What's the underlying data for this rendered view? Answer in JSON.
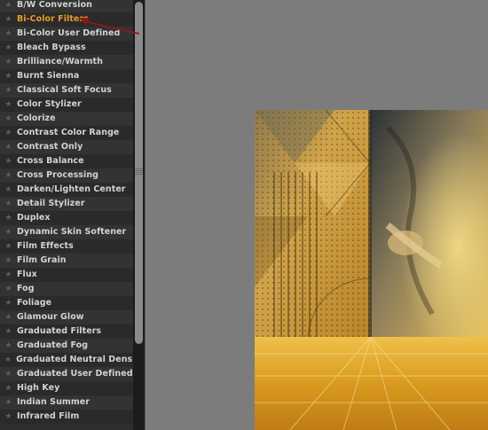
{
  "filter_panel": {
    "selected_index": 1,
    "items": [
      {
        "label": "B/W Conversion"
      },
      {
        "label": "Bi-Color Filters"
      },
      {
        "label": "Bi-Color User Defined"
      },
      {
        "label": "Bleach Bypass"
      },
      {
        "label": "Brilliance/Warmth"
      },
      {
        "label": "Burnt Sienna"
      },
      {
        "label": "Classical Soft Focus"
      },
      {
        "label": "Color Stylizer"
      },
      {
        "label": "Colorize"
      },
      {
        "label": "Contrast Color Range"
      },
      {
        "label": "Contrast Only"
      },
      {
        "label": "Cross Balance"
      },
      {
        "label": "Cross Processing"
      },
      {
        "label": "Darken/Lighten Center"
      },
      {
        "label": "Detail Stylizer"
      },
      {
        "label": "Duplex"
      },
      {
        "label": "Dynamic Skin Softener"
      },
      {
        "label": "Film Effects"
      },
      {
        "label": "Film Grain"
      },
      {
        "label": "Flux"
      },
      {
        "label": "Fog"
      },
      {
        "label": "Foliage"
      },
      {
        "label": "Glamour Glow"
      },
      {
        "label": "Graduated Filters"
      },
      {
        "label": "Graduated Fog"
      },
      {
        "label": "Graduated Neutral Density"
      },
      {
        "label": "Graduated User Defined"
      },
      {
        "label": "High Key"
      },
      {
        "label": "Indian Summer"
      },
      {
        "label": "Infrared Film"
      }
    ]
  },
  "colors": {
    "selected_label": "#e89a2b",
    "annotation_arrow": "#8b1a1a"
  },
  "icons": {
    "favorite_star": "star-icon",
    "annotation": "red-arrow-icon"
  }
}
